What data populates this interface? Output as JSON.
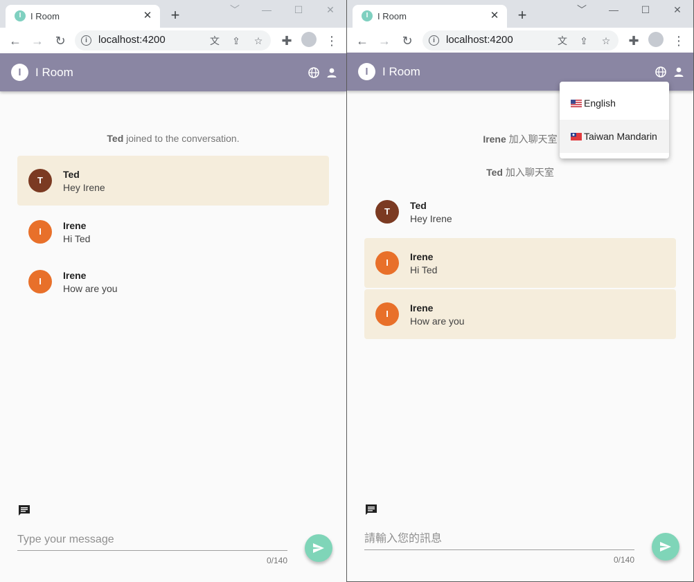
{
  "left": {
    "browser": {
      "tab_title": "I Room",
      "tab_close": "✕",
      "new_tab": "+",
      "url": "localhost:4200",
      "window_controls": [
        "﹀",
        "—",
        "☐",
        "✕"
      ]
    },
    "app": {
      "logo": "I",
      "title": "I Room"
    },
    "system_messages": [
      {
        "name": "Ted",
        "text": " joined to the conversation."
      }
    ],
    "messages": [
      {
        "avatar": "T",
        "name": "Ted",
        "text": "Hey Irene",
        "highlighted": true
      },
      {
        "avatar": "I",
        "name": "Irene",
        "text": "Hi Ted",
        "highlighted": false
      },
      {
        "avatar": "I",
        "name": "Irene",
        "text": "How are you",
        "highlighted": false
      }
    ],
    "composer": {
      "placeholder": "Type your message",
      "counter": "0/140"
    }
  },
  "right": {
    "browser": {
      "tab_title": "I Room",
      "tab_close": "✕",
      "new_tab": "+",
      "url": "localhost:4200",
      "window_controls": [
        "﹀",
        "—",
        "☐",
        "✕"
      ]
    },
    "app": {
      "logo": "I",
      "title": "I Room"
    },
    "system_messages": [
      {
        "name": "Irene",
        "text": " 加入聊天室"
      },
      {
        "name": "Ted",
        "text": " 加入聊天室"
      }
    ],
    "messages": [
      {
        "avatar": "T",
        "name": "Ted",
        "text": "Hey Irene",
        "highlighted": false
      },
      {
        "avatar": "I",
        "name": "Irene",
        "text": "Hi Ted",
        "highlighted": true
      },
      {
        "avatar": "I",
        "name": "Irene",
        "text": "How are you",
        "highlighted": true
      }
    ],
    "composer": {
      "placeholder": "請輸入您的訊息",
      "counter": "0/140"
    },
    "language_menu": {
      "items": [
        {
          "label": "English",
          "flag": "us-flag-icon",
          "active": false
        },
        {
          "label": "Taiwan Mandarin",
          "flag": "taiwan-flag-icon",
          "active": true
        }
      ]
    }
  },
  "colors": {
    "app_bar": "#8a86a3",
    "avatar_ted": "#7b3a22",
    "avatar_irene": "#e8702a",
    "highlight": "#f5eddc",
    "send_button": "#7fd5b8"
  }
}
